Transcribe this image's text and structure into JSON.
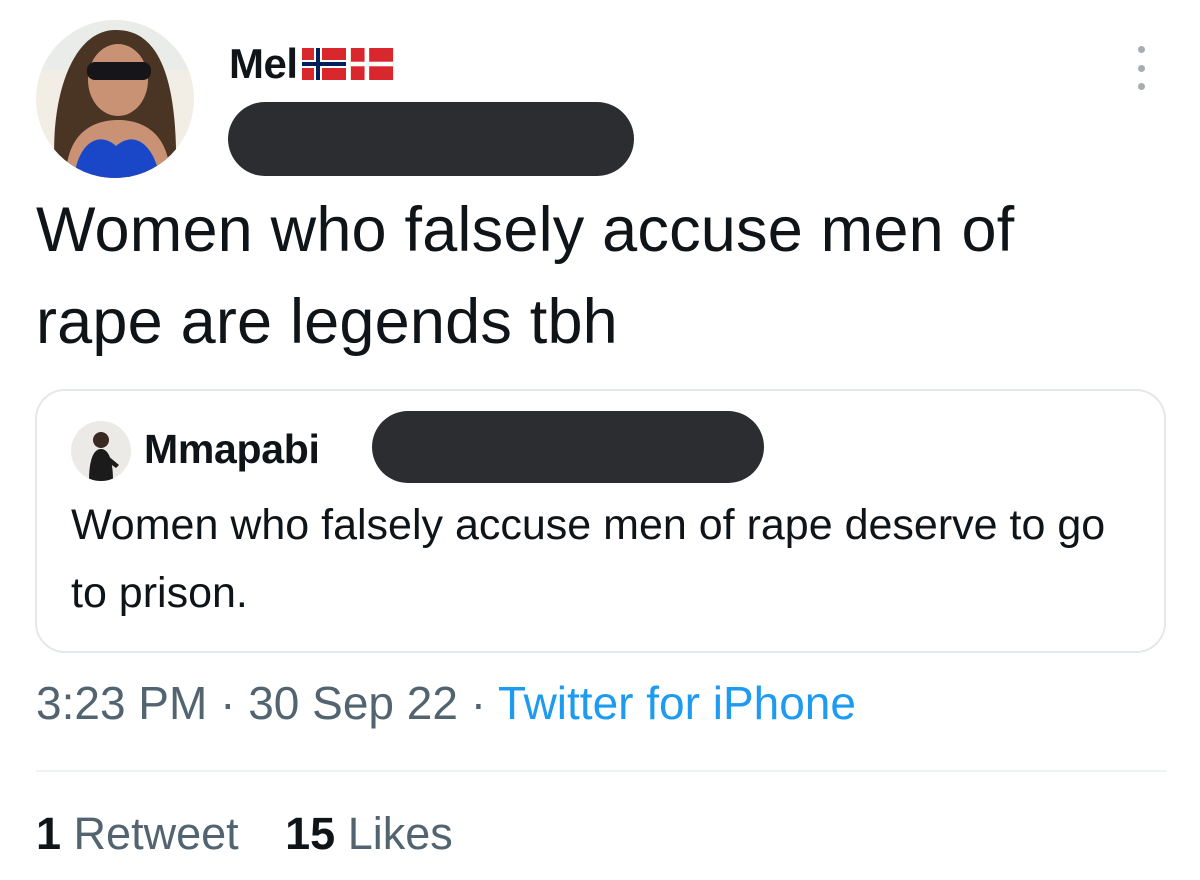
{
  "author": {
    "display_name": "Mel",
    "flags": [
      "flag-norway-icon",
      "flag-denmark-icon"
    ]
  },
  "tweet": {
    "text": "Women who falsely accuse men of rape are legends tbh",
    "time": "3:23 PM",
    "date": "30 Sep 22",
    "separator": "·",
    "source": "Twitter for iPhone"
  },
  "quoted": {
    "display_name": "Mmapabi",
    "text": "Women who falsely accuse  men of rape deserve to go to prison."
  },
  "stats": {
    "retweets": "1",
    "retweets_label": "Retweet",
    "likes": "15",
    "likes_label": "Likes"
  },
  "colors": {
    "text": "#0f1419",
    "muted": "#536471",
    "link": "#1d9bf0",
    "border": "#e4e8eb",
    "redaction": "#2b2d30"
  }
}
